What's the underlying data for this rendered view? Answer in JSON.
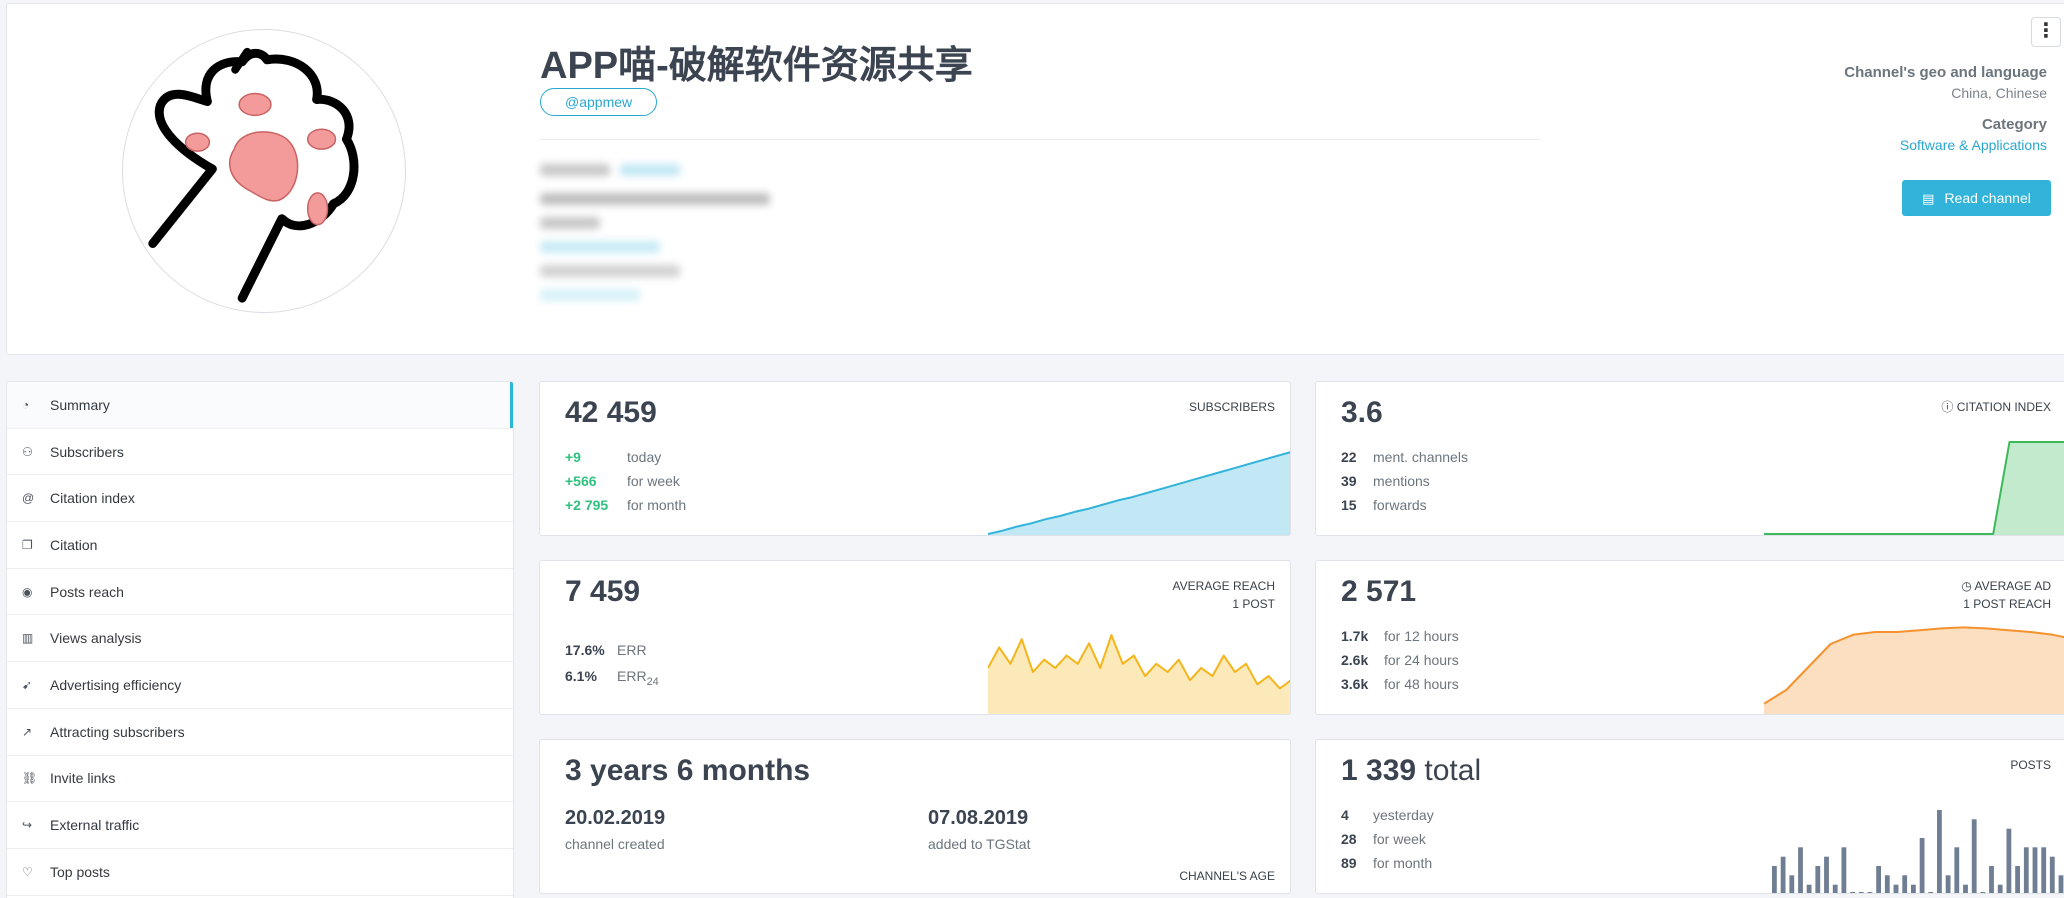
{
  "channel": {
    "title": "APP喵-破解软件资源共享",
    "handle": "@appmew",
    "geo_label": "Channel's geo and language",
    "geo_value": "China, Chinese",
    "category_label": "Category",
    "category_value": "Software & Applications",
    "read_button": "Read channel",
    "more_icon": "⋮"
  },
  "sidebar": {
    "items": [
      {
        "label": "Summary",
        "icon": "summary-icon",
        "glyph": "◔"
      },
      {
        "label": "Subscribers",
        "icon": "users-icon",
        "glyph": "⚇"
      },
      {
        "label": "Citation index",
        "icon": "at-icon",
        "glyph": "@"
      },
      {
        "label": "Citation",
        "icon": "comments-icon",
        "glyph": "❐"
      },
      {
        "label": "Posts reach",
        "icon": "eye-icon",
        "glyph": "◉"
      },
      {
        "label": "Views analysis",
        "icon": "bar-chart-icon",
        "glyph": "▥"
      },
      {
        "label": "Advertising efficiency",
        "icon": "rocket-icon",
        "glyph": "➹"
      },
      {
        "label": "Attracting subscribers",
        "icon": "trend-icon",
        "glyph": "↗"
      },
      {
        "label": "Invite links",
        "icon": "link-icon",
        "glyph": "⛓"
      },
      {
        "label": "External traffic",
        "icon": "share-icon",
        "glyph": "↪"
      },
      {
        "label": "Top posts",
        "icon": "thumbs-up-icon",
        "glyph": "♡"
      }
    ]
  },
  "subscribers_card": {
    "value": "42 459",
    "label": "SUBSCRIBERS",
    "rows": [
      {
        "n": "+9",
        "t": "today"
      },
      {
        "n": "+566",
        "t": "for week"
      },
      {
        "n": "+2 795",
        "t": "for month"
      }
    ],
    "color": "#31b3da"
  },
  "citation_card": {
    "value": "3.6",
    "label": "CITATION INDEX",
    "rows": [
      {
        "n": "22",
        "t": "ment. channels"
      },
      {
        "n": "39",
        "t": "mentions"
      },
      {
        "n": "15",
        "t": "forwards"
      }
    ],
    "color": "#3cb95a"
  },
  "reach_card": {
    "value": "7 459",
    "label_1": "AVERAGE REACH",
    "label_2": "1 POST",
    "err_value": "17.6%",
    "err_label": "ERR",
    "err24_value": "6.1%",
    "err24_label": "ERR",
    "err24_sub": "24",
    "color": "#f3b51a"
  },
  "ad_card": {
    "value": "2 571",
    "label_1": "AVERAGE AD",
    "label_2": "1 POST REACH",
    "rows": [
      {
        "n": "1.7k",
        "t": "for 12 hours"
      },
      {
        "n": "2.6k",
        "t": "for 24 hours"
      },
      {
        "n": "3.6k",
        "t": "for 48 hours"
      }
    ],
    "color": "#f5922e"
  },
  "age_card": {
    "value": "3 years 6 months",
    "created_date": "20.02.2019",
    "created_label": "channel created",
    "added_date": "07.08.2019",
    "added_label": "added to TGStat",
    "label": "CHANNEL'S AGE"
  },
  "posts_card": {
    "value": "1 339",
    "value_suffix": " total",
    "label": "POSTS",
    "rows": [
      {
        "n": "4",
        "t": "yesterday"
      },
      {
        "n": "28",
        "t": "for week"
      },
      {
        "n": "89",
        "t": "for month"
      }
    ],
    "color": "#6f7e93"
  },
  "charts": {
    "subscribers_trend": [
      0.0,
      0.04,
      0.09,
      0.13,
      0.18,
      0.22,
      0.27,
      0.31,
      0.36,
      0.41,
      0.45,
      0.5,
      0.55,
      0.6,
      0.65,
      0.7,
      0.75,
      0.8,
      0.85,
      0.9,
      0.95,
      1.0
    ],
    "citation_trend": [
      0,
      0,
      0,
      0,
      0,
      0,
      0,
      0,
      0,
      0,
      0,
      0,
      0,
      0,
      0,
      1,
      1,
      1,
      1,
      1
    ],
    "reach_trend": [
      0.55,
      0.8,
      0.6,
      0.9,
      0.5,
      0.65,
      0.55,
      0.7,
      0.6,
      0.85,
      0.55,
      0.95,
      0.6,
      0.7,
      0.45,
      0.6,
      0.5,
      0.65,
      0.4,
      0.55,
      0.45,
      0.7,
      0.5,
      0.6,
      0.35,
      0.45,
      0.3,
      0.4
    ],
    "ad_trend": [
      0.1,
      0.25,
      0.5,
      0.75,
      0.85,
      0.88,
      0.88,
      0.9,
      0.92,
      0.93,
      0.92,
      0.9,
      0.88,
      0.85,
      0.8
    ],
    "posts_bars": [
      3,
      4,
      2,
      5,
      1,
      3,
      4,
      1,
      5,
      0,
      0,
      0,
      3,
      2,
      1,
      2,
      1,
      6,
      0,
      9,
      2,
      5,
      1,
      8,
      0,
      3,
      1,
      7,
      3,
      5,
      5,
      5,
      4,
      2,
      4
    ]
  }
}
